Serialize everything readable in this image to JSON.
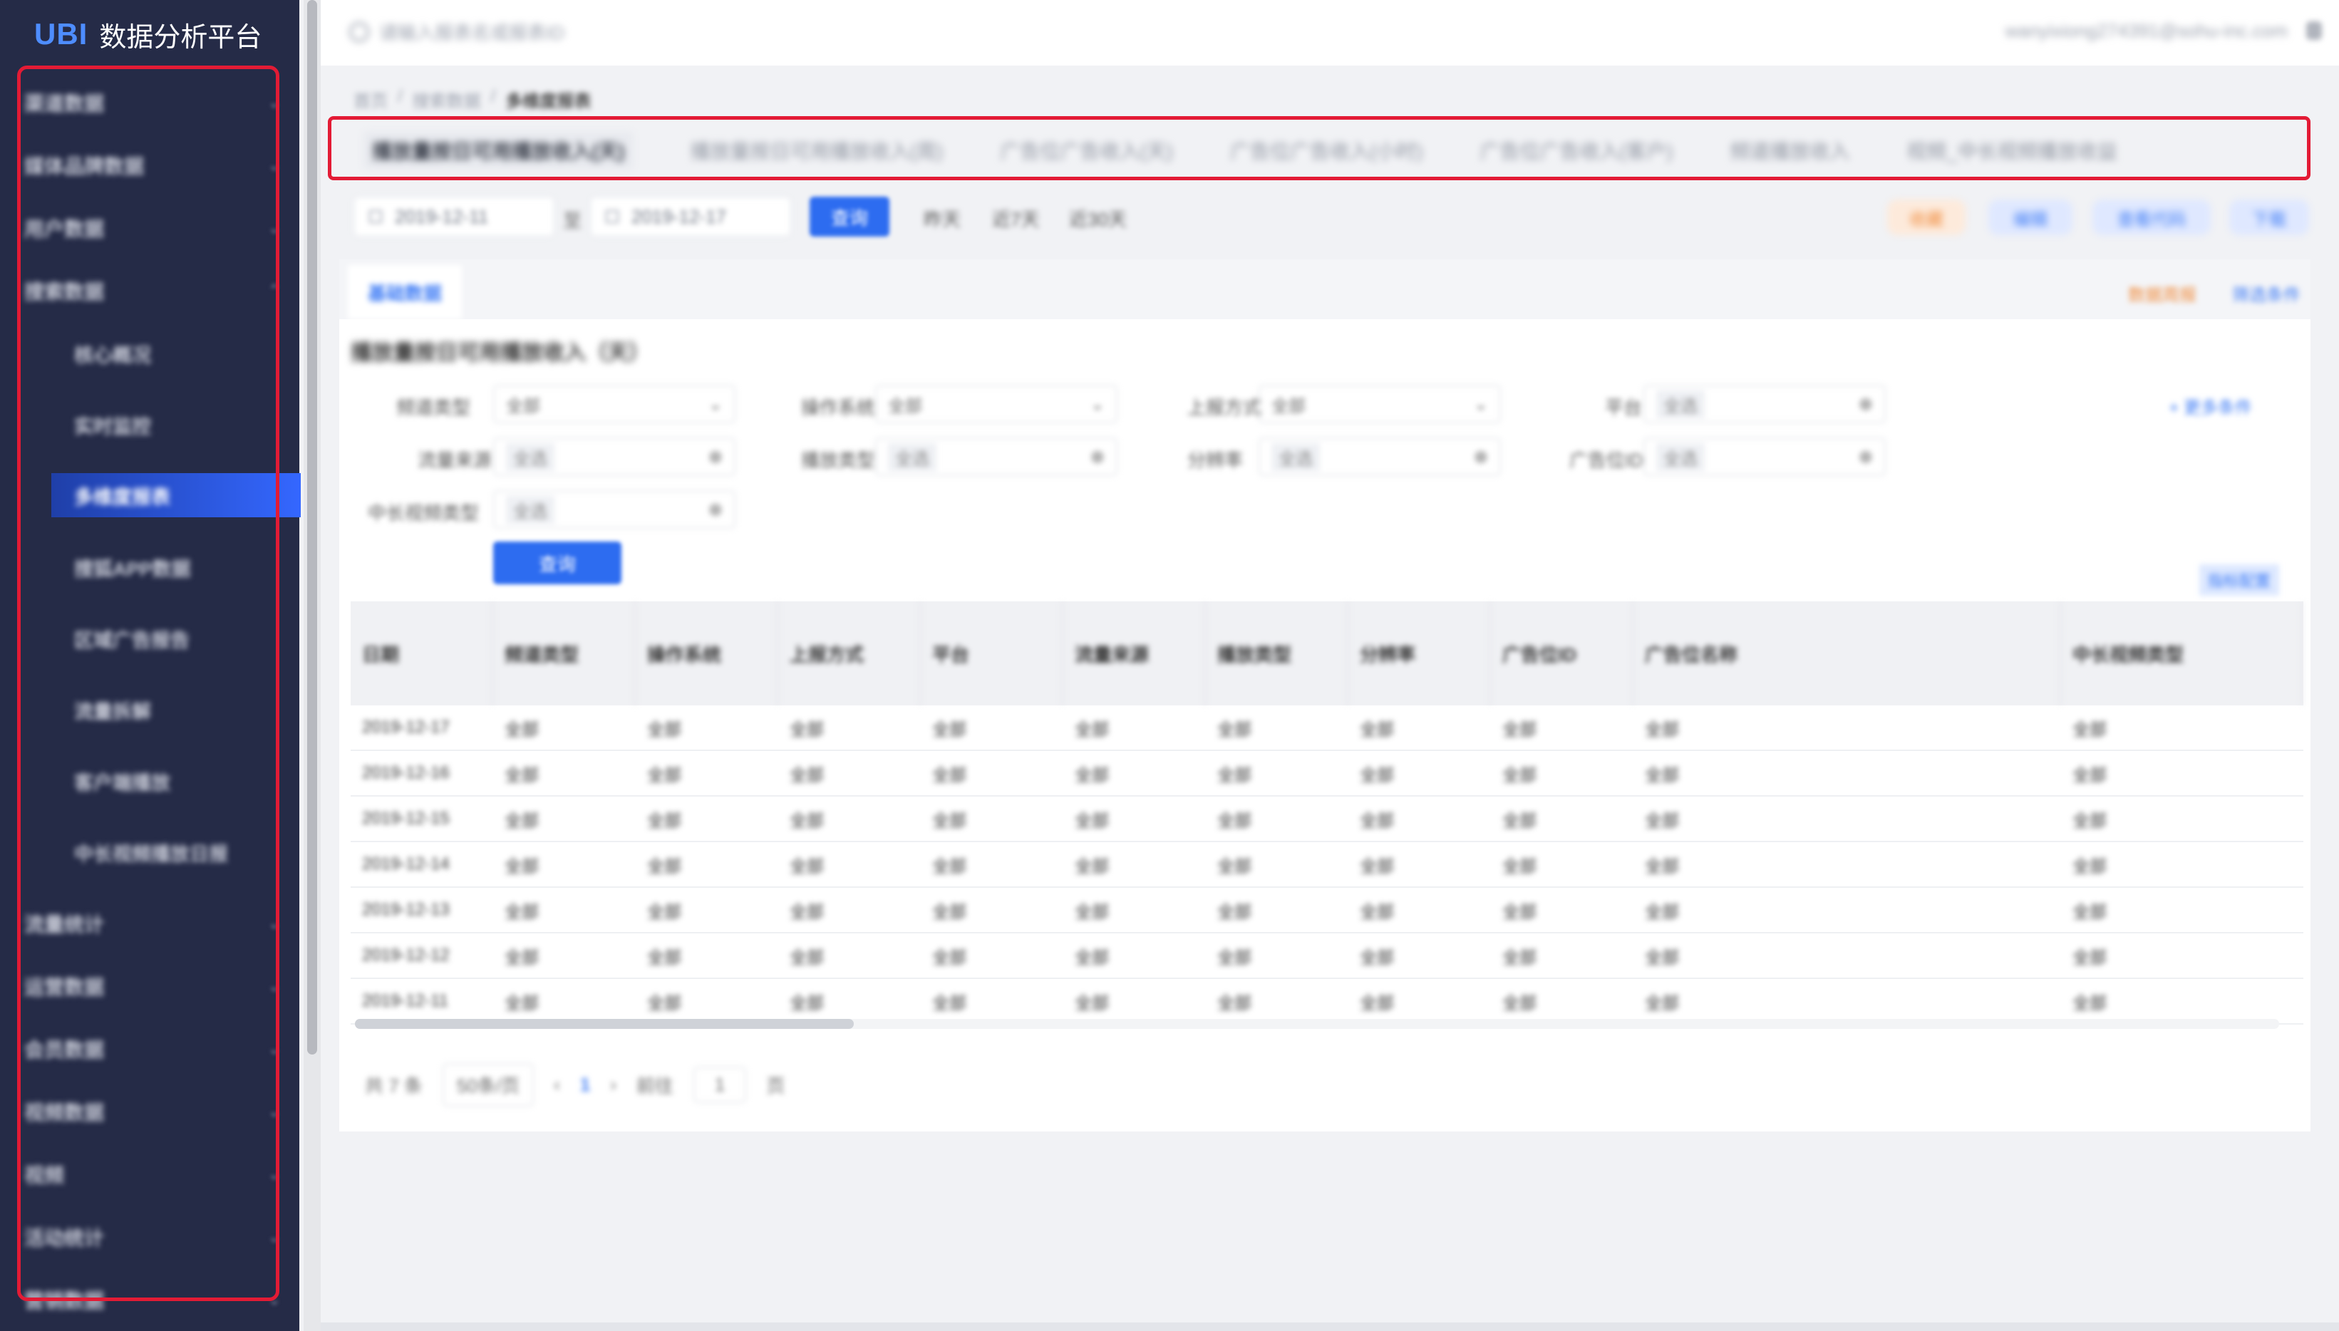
{
  "app": {
    "brand": "UBI",
    "title": "数据分析平台"
  },
  "topbar": {
    "search_placeholder": "请输入报表名或报表ID",
    "user": "wanyixiong274391@sohu-inc.com"
  },
  "sidebar": {
    "items": [
      {
        "label": "渠道数据"
      },
      {
        "label": "媒体品牌数据"
      },
      {
        "label": "用户数据"
      },
      {
        "label": "搜索数据"
      },
      {
        "label": "流量统计"
      },
      {
        "label": "运营数据"
      },
      {
        "label": "会员数据"
      },
      {
        "label": "视频数据"
      },
      {
        "label": "视频"
      },
      {
        "label": "活动统计"
      },
      {
        "label": "营销数据"
      }
    ],
    "subitems": [
      {
        "label": "核心概况"
      },
      {
        "label": "实时监控"
      },
      {
        "label": "多维度报表"
      },
      {
        "label": "搜狐APP数据"
      },
      {
        "label": "区域广告报告"
      },
      {
        "label": "流量拆解"
      },
      {
        "label": "客户端播放"
      },
      {
        "label": "中长视频播放日报"
      }
    ]
  },
  "breadcrumb": {
    "home": "首页",
    "section": "搜索数据",
    "current": "多维度报表"
  },
  "tabs": [
    "播放量按日可用播放收入(天)",
    "播放量按日可用播放收入(周)",
    "广告位广告收入(天)",
    "广告位广告收入(小时)",
    "广告位广告收入(客户)",
    "频道播放收入",
    "视频_中长视频播放收益"
  ],
  "filters": {
    "date_start": "2019-12-11",
    "date_sep": "至",
    "date_end": "2019-12-17",
    "query": "查询",
    "quick": [
      "昨天",
      "近7天",
      "近30天"
    ],
    "actions": [
      "收藏",
      "编辑",
      "查看代码",
      "下载"
    ]
  },
  "card": {
    "tab_active": "基础数据",
    "links": [
      "数据周报",
      "筛选条件"
    ],
    "section_title": "播放量按日可用播放收入（天）",
    "fields": [
      {
        "label": "频道类型",
        "value": "全部",
        "kind": "select"
      },
      {
        "label": "操作系统",
        "value": "全部",
        "kind": "select"
      },
      {
        "label": "上报方式",
        "value": "全部",
        "kind": "select"
      },
      {
        "label": "平台",
        "value": "全选",
        "kind": "tags"
      },
      {
        "label": "流量来源",
        "value": "全选",
        "kind": "tags"
      },
      {
        "label": "播放类型",
        "value": "全选",
        "kind": "tags"
      },
      {
        "label": "分辨率",
        "value": "全选",
        "kind": "tags"
      },
      {
        "label": "广告位ID",
        "value": "全选",
        "kind": "tags"
      },
      {
        "label": "中长视频类型",
        "value": "全选",
        "kind": "tags"
      }
    ],
    "search_btn": "查询",
    "more": "+ 更多条件",
    "col_btn": "指标配置"
  },
  "table": {
    "columns": [
      "日期",
      "频道类型",
      "操作系统",
      "上报方式",
      "平台",
      "流量来源",
      "播放类型",
      "分辨率",
      "广告位ID",
      "广告位名称",
      "中长视频类型"
    ],
    "rows": [
      [
        "2019-12-17",
        "全部",
        "全部",
        "全部",
        "全部",
        "全部",
        "全部",
        "全部",
        "全部",
        "全部",
        "全部"
      ],
      [
        "2019-12-16",
        "全部",
        "全部",
        "全部",
        "全部",
        "全部",
        "全部",
        "全部",
        "全部",
        "全部",
        "全部"
      ],
      [
        "2019-12-15",
        "全部",
        "全部",
        "全部",
        "全部",
        "全部",
        "全部",
        "全部",
        "全部",
        "全部",
        "全部"
      ],
      [
        "2019-12-14",
        "全部",
        "全部",
        "全部",
        "全部",
        "全部",
        "全部",
        "全部",
        "全部",
        "全部",
        "全部"
      ],
      [
        "2019-12-13",
        "全部",
        "全部",
        "全部",
        "全部",
        "全部",
        "全部",
        "全部",
        "全部",
        "全部",
        "全部"
      ],
      [
        "2019-12-12",
        "全部",
        "全部",
        "全部",
        "全部",
        "全部",
        "全部",
        "全部",
        "全部",
        "全部",
        "全部"
      ],
      [
        "2019-12-11",
        "全部",
        "全部",
        "全部",
        "全部",
        "全部",
        "全部",
        "全部",
        "全部",
        "全部",
        "全部"
      ]
    ]
  },
  "pager": {
    "total": "共 7 条",
    "size": "50条/页",
    "current": "1",
    "goto": "前往",
    "goto_val": "1",
    "page": "页"
  },
  "colors": {
    "sidebar": "#252b47",
    "primary": "#2d6cf0",
    "highlight": "#e31b35"
  }
}
